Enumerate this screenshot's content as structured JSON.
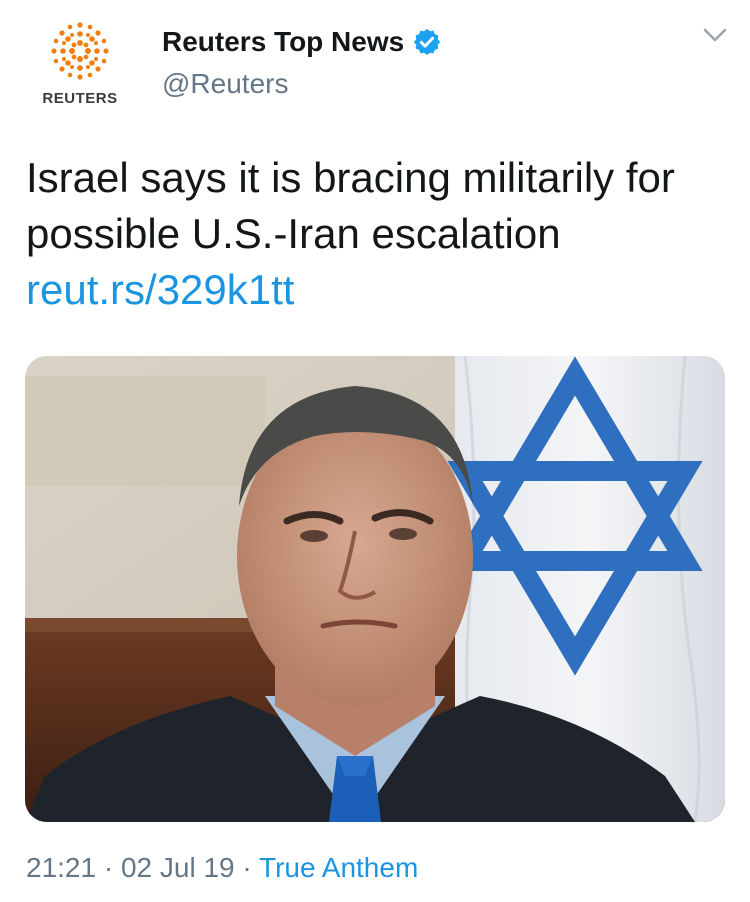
{
  "header": {
    "logo_text": "REUTERS",
    "display_name": "Reuters Top News",
    "handle": "@Reuters",
    "verified_icon": "verified-badge-icon",
    "menu_icon": "chevron-down-icon"
  },
  "tweet": {
    "text": "Israel says it is bracing militarily for possible U.S.-Iran escalation",
    "link": "reut.rs/329k1tt"
  },
  "media": {
    "icon": "star-of-david-icon"
  },
  "meta": {
    "time": "21:21",
    "sep1": " · ",
    "date": "02 Jul 19",
    "sep2": " · ",
    "source": "True Anthem"
  },
  "colors": {
    "link": "#1b95e0",
    "secondary_text": "#657786",
    "logo_orange": "#f07f12",
    "flag_blue": "#2f6fc0"
  }
}
